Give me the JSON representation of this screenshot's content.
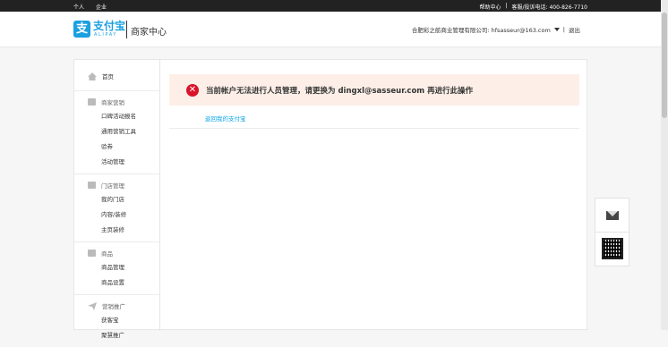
{
  "topbar": {
    "left": [
      "个人",
      "企业"
    ],
    "help": "帮助中心",
    "sep": "|",
    "hotline": "客服/投诉电话: 400-826-7710"
  },
  "header": {
    "logo_char": "支",
    "logo_text": "支付宝",
    "logo_sub": "ALIPAY",
    "title": "商家中心",
    "account": "合肥彩之舫商业管理有限公司: hfsasseur@163.com",
    "logout": "退出",
    "sep": "|"
  },
  "sidebar": {
    "home": "首页",
    "groups": [
      {
        "title": "商家营销",
        "icon": "mail-icon",
        "items": [
          "口碑活动报名",
          "通用营销工具",
          "验券",
          "活动管理"
        ]
      },
      {
        "title": "门店管理",
        "icon": "store-icon",
        "items": [
          "我的门店",
          "内容/装修",
          "主页装修"
        ]
      },
      {
        "title": "商品",
        "icon": "product-icon",
        "items": [
          "商品管理",
          "商品设置"
        ]
      },
      {
        "title": "营销推广",
        "icon": "send-icon",
        "items": [
          "获客宝",
          "聚慧推广"
        ]
      }
    ]
  },
  "content": {
    "error_glyph": "✕",
    "alert": "当前帐户无法进行人员管理，请更换为 dingxl@sasseur.com 再进行此操作",
    "back_link": "返回我的支付宝"
  },
  "colors": {
    "brand": "#1aa0e0",
    "error": "#d9142a",
    "alert_bg": "#fdefe8",
    "link": "#0aa5e8"
  }
}
